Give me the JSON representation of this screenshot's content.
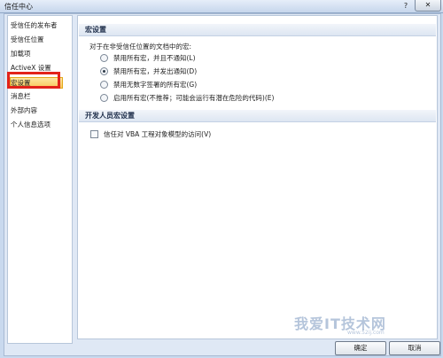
{
  "window": {
    "title": "信任中心",
    "help_glyph": "?",
    "close_glyph": "✕"
  },
  "sidebar": {
    "items": [
      {
        "label": "受信任的发布者"
      },
      {
        "label": "受信任位置"
      },
      {
        "label": "加载项"
      },
      {
        "label": "ActiveX 设置"
      },
      {
        "label": "宏设置"
      },
      {
        "label": "消息栏"
      },
      {
        "label": "外部内容"
      },
      {
        "label": "个人信息选项"
      }
    ],
    "selected": "宏设置",
    "highlight_color": "#e2231a"
  },
  "macro_section": {
    "header": "宏设置",
    "intro": "对于在非受信任位置的文档中的宏:",
    "options": [
      {
        "label": "禁用所有宏，并且不通知(L)",
        "checked": false
      },
      {
        "label": "禁用所有宏，并发出通知(D)",
        "checked": true
      },
      {
        "label": "禁用无数字签署的所有宏(G)",
        "checked": false
      },
      {
        "label": "启用所有宏(不推荐；可能会运行有潜在危险的代码)(E)",
        "checked": false
      }
    ]
  },
  "developer_section": {
    "header": "开发人员宏设置",
    "checkbox_label": "信任对 VBA 工程对象模型的访问(V)",
    "checkbox_checked": false
  },
  "buttons": {
    "ok": "确定",
    "cancel": "取消"
  },
  "watermark": {
    "text": "我爱IT技术网",
    "url": "www.52ij.com"
  }
}
